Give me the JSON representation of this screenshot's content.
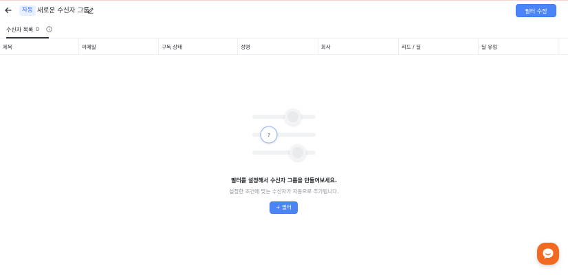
{
  "header": {
    "badge": "자동",
    "title": "새로운 수신자 그룹",
    "filter_edit_label": "필터 수정"
  },
  "tabs": [
    {
      "label": "수신자 목록",
      "count": "0"
    }
  ],
  "table": {
    "columns": [
      "제목",
      "이메일",
      "구독 상태",
      "성명",
      "회사",
      "리드 / 딜",
      "딜 유형"
    ]
  },
  "empty_state": {
    "title": "필터를 설정해서 수신자 그룹을 만들어보세요.",
    "subtitle": "설정한 조건에 맞는 수신자가 자동으로 추가됩니다.",
    "add_filter_label": "필터",
    "add_filter_icon": "+",
    "illustration_marker": "?"
  },
  "icons": {
    "back": "arrow-left-icon",
    "edit": "pencil-icon",
    "info": "info-icon",
    "chat": "chat-bubble-icon"
  },
  "colors": {
    "accent": "#4a84f6",
    "badge_bg": "#e7f0ff",
    "chat": "#f26a21"
  }
}
